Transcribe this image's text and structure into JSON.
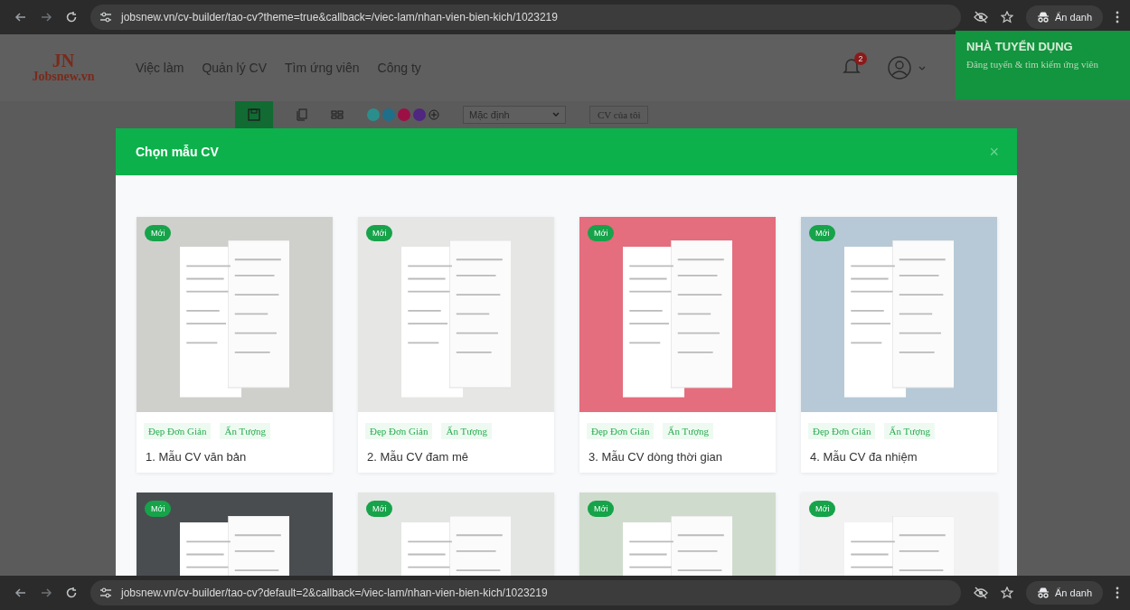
{
  "browser_top": {
    "url": "jobsnew.vn/cv-builder/tao-cv?theme=true&callback=/viec-lam/nhan-vien-bien-kich/1023219",
    "profile_label": "Ẩn danh"
  },
  "site_header": {
    "logo_mark": "JN",
    "logo_text": "Jobsnew.vn",
    "nav": [
      "Việc làm",
      "Quản lý CV",
      "Tìm ứng viên",
      "Công ty"
    ],
    "notification_count": "2",
    "employer": {
      "title": "NHÀ TUYỂN DỤNG",
      "subtitle": "Đăng tuyển & tìm kiếm ứng viên"
    }
  },
  "toolbar": {
    "colors": [
      {
        "color": "#2a8f8c"
      },
      {
        "color": "#1f6f8b"
      },
      {
        "color": "#9c1046"
      },
      {
        "color": "#4f2680"
      }
    ],
    "font_select": "Mặc định",
    "my_cv_button": "CV của tôi"
  },
  "modal": {
    "title": "Chọn mẫu CV",
    "close": "×",
    "templates": [
      {
        "badge": "Mới",
        "tags": [
          "Đẹp Đơn Giản",
          "Ấn Tượng"
        ],
        "title": "1. Mẫu CV văn bản"
      },
      {
        "badge": "Mới",
        "tags": [
          "Đẹp Đơn Giản",
          "Ấn Tượng"
        ],
        "title": "2. Mẫu CV đam mê"
      },
      {
        "badge": "Mới",
        "tags": [
          "Đẹp Đơn Giản",
          "Ấn Tượng"
        ],
        "title": "3. Mẫu CV dòng thời gian"
      },
      {
        "badge": "Mới",
        "tags": [
          "Đẹp Đơn Giản",
          "Ấn Tượng"
        ],
        "title": "4. Mẫu CV đa nhiệm"
      },
      {
        "badge": "Mới"
      },
      {
        "badge": "Mới"
      },
      {
        "badge": "Mới"
      },
      {
        "badge": "Mới"
      }
    ]
  },
  "browser_bottom": {
    "url": "jobsnew.vn/cv-builder/tao-cv?default=2&callback=/viec-lam/nhan-vien-bien-kich/1023219",
    "profile_label": "Ẩn danh"
  }
}
